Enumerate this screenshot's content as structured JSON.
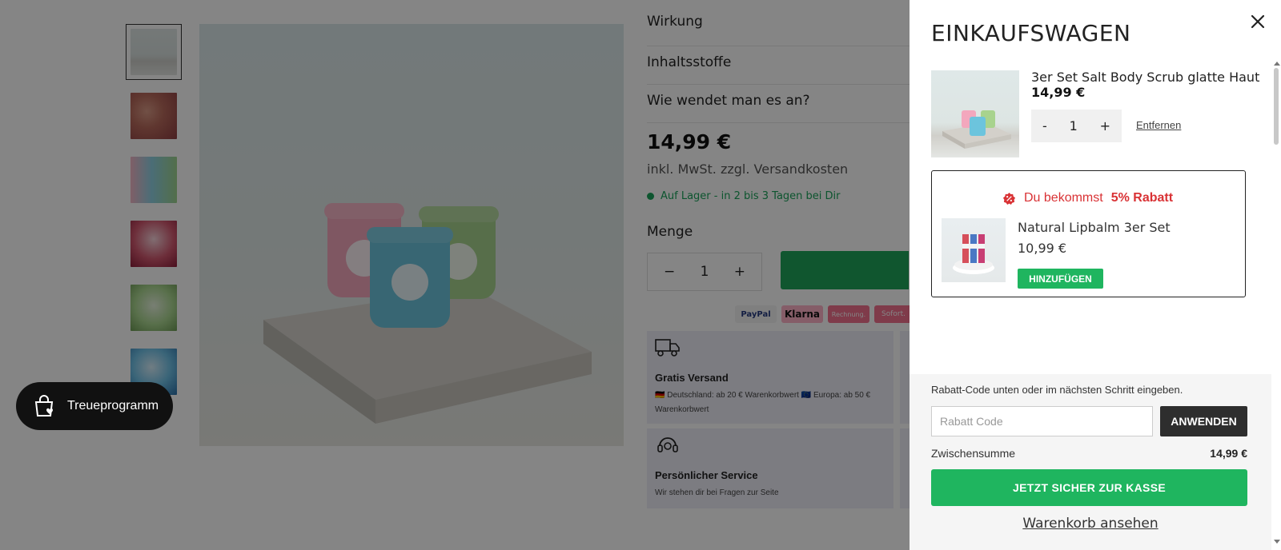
{
  "page": {
    "accordion": [
      "Wirkung",
      "Inhaltsstoffe",
      "Wie wendet man es an?"
    ],
    "price": "14,99 €",
    "vat_note": "inkl. MwSt. zzgl. Versandkosten",
    "stock": "Auf Lager - in 2 bis 3 Tagen bei Dir",
    "quantity_label": "Menge",
    "quantity": "1",
    "minus": "−",
    "plus": "+",
    "payments": [
      "PayPal",
      "Klarna",
      "Rechnung.",
      "Sofort."
    ],
    "usp": {
      "shipping_title": "Gratis Versand",
      "shipping_text": "🇩🇪 Deutschland: ab 20 € Warenkorbwert 🇪🇺 Europa: ab 50 € Warenkorbwert",
      "service_title": "Persönlicher Service",
      "service_text": "Wir stehen dir bei Fragen zur Seite"
    },
    "loyalty_label": "Treueprogramm"
  },
  "cart": {
    "title": "EINKAUFSWAGEN",
    "item": {
      "name": "3er Set Salt Body Scrub glatte Haut",
      "price": "14,99 €",
      "quantity": "1",
      "minus": "-",
      "plus": "+",
      "remove": "Entfernen"
    },
    "upsell": {
      "lead": "Du bekommst",
      "highlight": "5% Rabatt",
      "name": "Natural Lipbalm 3er Set",
      "price": "10,99 €",
      "add": "HINZUFÜGEN"
    },
    "discount_hint": "Rabatt-Code unten oder im nächsten Schritt eingeben.",
    "discount_placeholder": "Rabatt Code",
    "apply": "ANWENDEN",
    "subtotal_label": "Zwischensumme",
    "subtotal_value": "14,99 €",
    "checkout": "JETZT SICHER ZUR KASSE",
    "view_cart": "Warenkorb ansehen"
  },
  "colors": {
    "accent_green": "#1fb55f",
    "discount_red": "#d93235",
    "overlay": "rgba(0,0,0,0.48)"
  }
}
